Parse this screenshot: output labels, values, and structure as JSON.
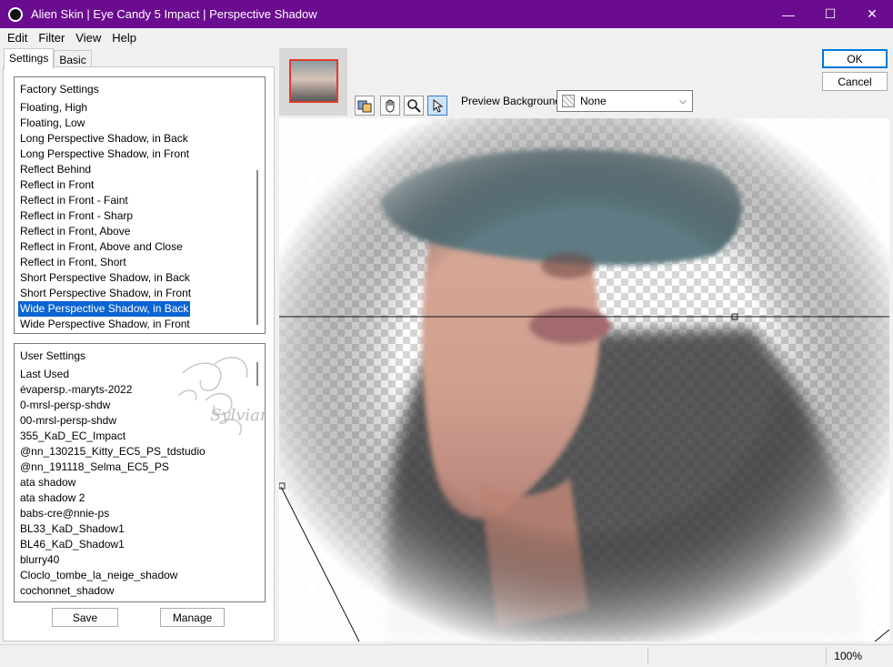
{
  "window": {
    "title": "Alien Skin | Eye Candy 5 Impact | Perspective Shadow"
  },
  "menu": [
    "Edit",
    "Filter",
    "View",
    "Help"
  ],
  "tabs": {
    "settings": "Settings",
    "basic": "Basic"
  },
  "factory": {
    "header": "Factory Settings",
    "items": [
      "Floating, High",
      "Floating, Low",
      "Long Perspective Shadow, in Back",
      "Long Perspective Shadow, in Front",
      "Reflect Behind",
      "Reflect in Front",
      "Reflect in Front - Faint",
      "Reflect in Front - Sharp",
      "Reflect in Front, Above",
      "Reflect in Front, Above and Close",
      "Reflect in Front, Short",
      "Short Perspective Shadow, in Back",
      "Short Perspective Shadow, in Front",
      "Wide Perspective Shadow, in Back",
      "Wide Perspective Shadow, in Front"
    ],
    "selected": "Wide Perspective Shadow, in Back"
  },
  "user": {
    "header": "User Settings",
    "items": [
      "Last Used",
      "évapersp.-maryts-2022",
      "0-mrsl-persp-shdw",
      "00-mrsl-persp-shdw",
      "355_KaD_EC_Impact",
      "@nn_130215_Kitty_EC5_PS_tdstudio",
      "@nn_191118_Selma_EC5_PS",
      "ata shadow",
      "ata shadow 2",
      "babs-cre@nnie-ps",
      "BL33_KaD_Shadow1",
      "BL46_KaD_Shadow1",
      "blurry40",
      "Cloclo_tombe_la_neige_shadow",
      "cochonnet_shadow"
    ]
  },
  "watermark": "Sylviane",
  "buttons": {
    "save": "Save",
    "manage": "Manage",
    "ok": "OK",
    "cancel": "Cancel"
  },
  "preview": {
    "background_label": "Preview Background:",
    "background_value": "None"
  },
  "status": {
    "zoom": "100%"
  },
  "colors": {
    "titlebar": "#6b0b8f",
    "selection": "#0a64d2",
    "accent": "#0078d7"
  }
}
